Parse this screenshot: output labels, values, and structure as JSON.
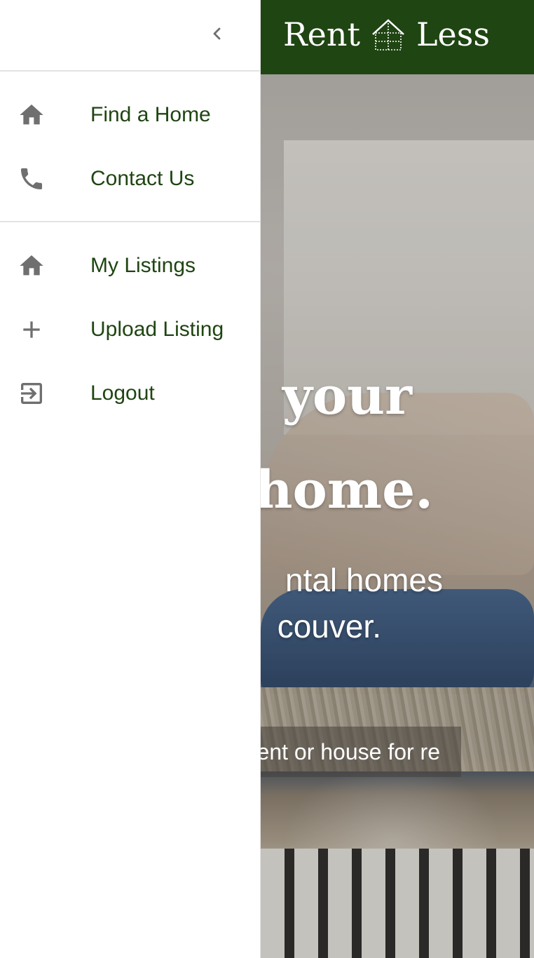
{
  "brand": {
    "name_left": "Rent",
    "name_right": "Less"
  },
  "hero": {
    "title_line1": "your",
    "title_line2": "home.",
    "subtitle_line1": "ntal homes",
    "subtitle_line2": "couver.",
    "search_value": "ent or house for re"
  },
  "drawer": {
    "primary": [
      {
        "label": "Find a Home",
        "icon": "home-icon"
      },
      {
        "label": "Contact Us",
        "icon": "phone-icon"
      }
    ],
    "secondary": [
      {
        "label": "My Listings",
        "icon": "home-icon"
      },
      {
        "label": "Upload Listing",
        "icon": "plus-icon"
      },
      {
        "label": "Logout",
        "icon": "logout-icon"
      }
    ]
  },
  "colors": {
    "brand_green": "#1f4512",
    "icon_gray": "#6f6f6f",
    "drawer_bg": "#ffffff"
  }
}
